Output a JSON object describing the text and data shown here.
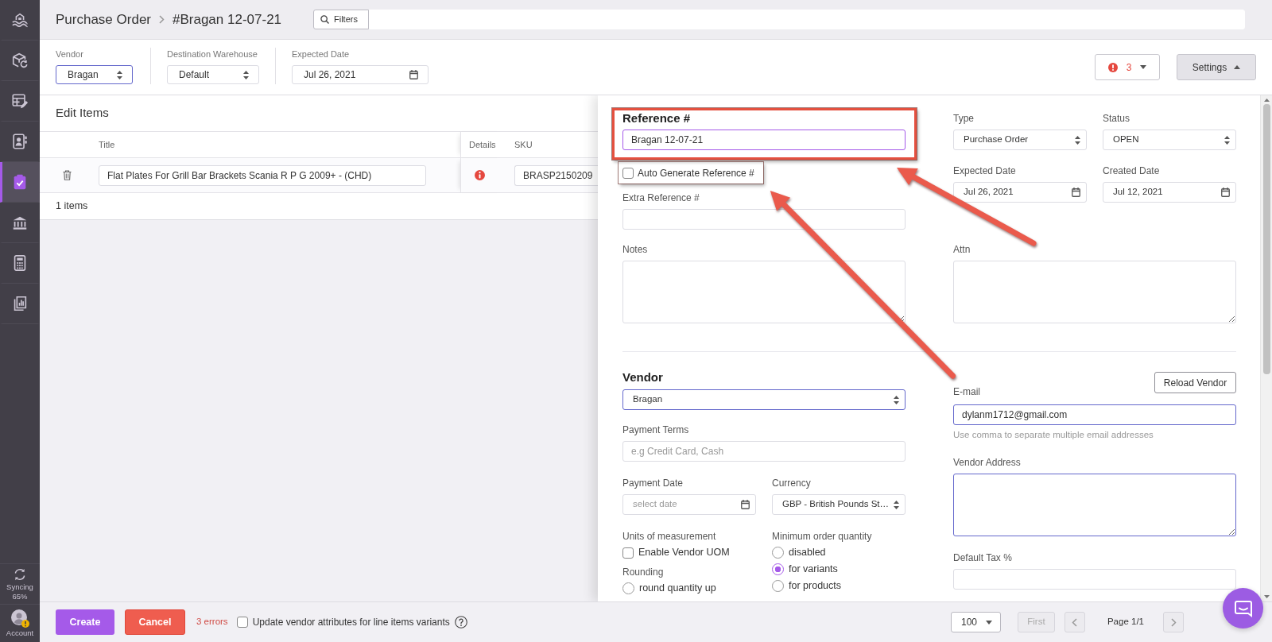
{
  "sidebar": {
    "items": [
      {
        "kind": "waves",
        "selected": false
      },
      {
        "kind": "box-sync",
        "selected": false
      },
      {
        "kind": "table-edit",
        "selected": false
      },
      {
        "kind": "contacts",
        "selected": false
      },
      {
        "kind": "clipboard-check",
        "selected": true
      },
      {
        "kind": "bank",
        "selected": false
      },
      {
        "kind": "calculator",
        "selected": false
      },
      {
        "kind": "reports",
        "selected": false
      }
    ],
    "sync": {
      "label": "Syncing",
      "percent": "65%"
    },
    "account": {
      "label": "Account",
      "warning": true
    }
  },
  "header": {
    "breadcrumb": [
      "Purchase Order",
      "#Bragan 12-07-21"
    ],
    "filters_button": "Filters"
  },
  "toolbar": {
    "fields": [
      {
        "kind": "select",
        "label": "Vendor",
        "value": "Bragan",
        "outlined": true
      },
      {
        "kind": "select",
        "label": "Destination Warehouse",
        "value": "Default",
        "outlined": false
      },
      {
        "kind": "date",
        "label": "Expected Date",
        "value": "Jul 26, 2021",
        "outlined": false
      }
    ],
    "error_button": {
      "count": "3"
    },
    "settings_button": {
      "label": "Settings",
      "expanded": true
    }
  },
  "edit_items": {
    "title": "Edit Items",
    "columns": [
      "Title",
      "Details",
      "SKU"
    ],
    "rows": [
      {
        "title": "Flat Plates For Grill Bar Brackets Scania R P G 2009+ - (CHD)",
        "details_alert": true,
        "sku": "BRASP2150209"
      }
    ],
    "footer": "1 items"
  },
  "settings_panel": {
    "reference": {
      "label": "Reference #",
      "value": "Bragan 12-07-21",
      "focused": true,
      "highlighted": true
    },
    "auto_generate": {
      "label": "Auto Generate Reference #",
      "checked": false,
      "highlighted": true
    },
    "extra_reference": {
      "label": "Extra Reference #"
    },
    "notes": {
      "label": "Notes"
    },
    "type": {
      "label": "Type",
      "value": "Purchase Order"
    },
    "status": {
      "label": "Status",
      "value": "OPEN"
    },
    "expected_date": {
      "label": "Expected Date",
      "value": "Jul 26, 2021"
    },
    "created_date": {
      "label": "Created Date",
      "value": "Jul 12, 2021"
    },
    "attn": {
      "label": "Attn"
    },
    "vendor": {
      "heading": "Vendor",
      "value": "Bragan",
      "outlined": true
    },
    "payment_terms": {
      "label": "Payment Terms",
      "placeholder": "e.g Credit Card, Cash"
    },
    "payment_date": {
      "label": "Payment Date",
      "placeholder": "select date"
    },
    "currency": {
      "label": "Currency",
      "value": "GBP - British Pounds St…"
    },
    "units": {
      "label": "Units of measurement",
      "option": {
        "label": "Enable Vendor UOM",
        "checked": false
      }
    },
    "rounding": {
      "label": "Rounding",
      "options": [
        {
          "label": "round quantity up",
          "selected": false
        }
      ]
    },
    "minimum_order": {
      "label": "Minimum order quantity",
      "options": [
        {
          "label": "disabled",
          "selected": false
        },
        {
          "label": "for variants",
          "selected": true
        },
        {
          "label": "for products",
          "selected": false
        }
      ]
    },
    "reload_button": "Reload Vendor",
    "email": {
      "label": "E-mail",
      "value": "dylanm1712@gmail.com",
      "outlined": true,
      "help": "Use comma to separate multiple email addresses"
    },
    "vendor_address": {
      "label": "Vendor Address",
      "outlined": true
    },
    "default_tax": {
      "label": "Default Tax %"
    }
  },
  "footer": {
    "create_button": "Create",
    "cancel_button": "Cancel",
    "errors": "3 errors",
    "update_vendor": {
      "label": "Update vendor attributes for line items variants",
      "checked": false
    },
    "pagination": {
      "page_size": "100",
      "first": {
        "label": "First",
        "disabled": true
      },
      "previous": {
        "disabled": true
      },
      "page_label": "Page 1/1",
      "next": {
        "disabled": true
      }
    }
  }
}
